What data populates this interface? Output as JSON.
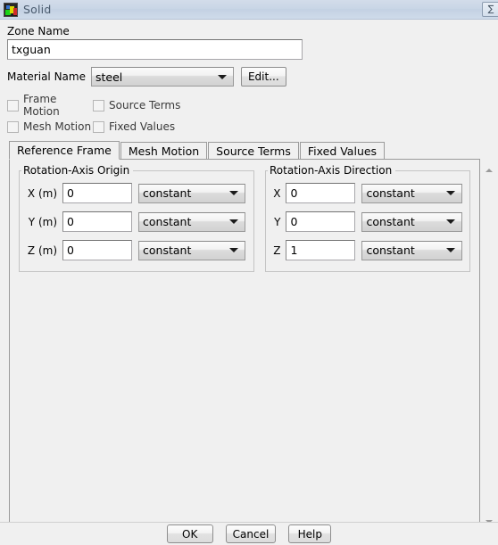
{
  "window": {
    "title": "Solid",
    "icon": "fluent-app-icon",
    "buttons": [
      {
        "name": "minimize-restore-button",
        "glyph": "∑"
      }
    ]
  },
  "zone": {
    "label": "Zone Name",
    "value": "txguan",
    "placeholder": ""
  },
  "material": {
    "label": "Material Name",
    "value": "steel",
    "edit_label": "Edit..."
  },
  "options": {
    "row1": [
      {
        "label": "Frame Motion",
        "checked": false
      },
      {
        "label": "Source Terms",
        "checked": false
      }
    ],
    "row2": [
      {
        "label": "Mesh Motion",
        "checked": false
      },
      {
        "label": "Fixed Values",
        "checked": false
      }
    ]
  },
  "tabs": [
    {
      "label": "Reference Frame",
      "active": true
    },
    {
      "label": "Mesh Motion",
      "active": false
    },
    {
      "label": "Source Terms",
      "active": false
    },
    {
      "label": "Fixed Values",
      "active": false
    }
  ],
  "rotation_axis_origin": {
    "title": "Rotation-Axis Origin",
    "rows": [
      {
        "axis": "X (m)",
        "value": "0",
        "method": "constant"
      },
      {
        "axis": "Y (m)",
        "value": "0",
        "method": "constant"
      },
      {
        "axis": "Z (m)",
        "value": "0",
        "method": "constant"
      }
    ]
  },
  "rotation_axis_direction": {
    "title": "Rotation-Axis Direction",
    "rows": [
      {
        "axis": "X",
        "value": "0",
        "method": "constant"
      },
      {
        "axis": "Y",
        "value": "0",
        "method": "constant"
      },
      {
        "axis": "Z",
        "value": "1",
        "method": "constant"
      }
    ]
  },
  "scrollbar": {
    "up_arrow": "scroll-up-arrow",
    "down_arrow": "scroll-down-arrow"
  },
  "footer": {
    "ok": "OK",
    "cancel": "Cancel",
    "help": "Help"
  },
  "colors": {
    "titlebar": "#c9d6e6",
    "panel": "#f0f0f0",
    "input_bg": "#ffffff",
    "border": "#9b9b9b"
  }
}
